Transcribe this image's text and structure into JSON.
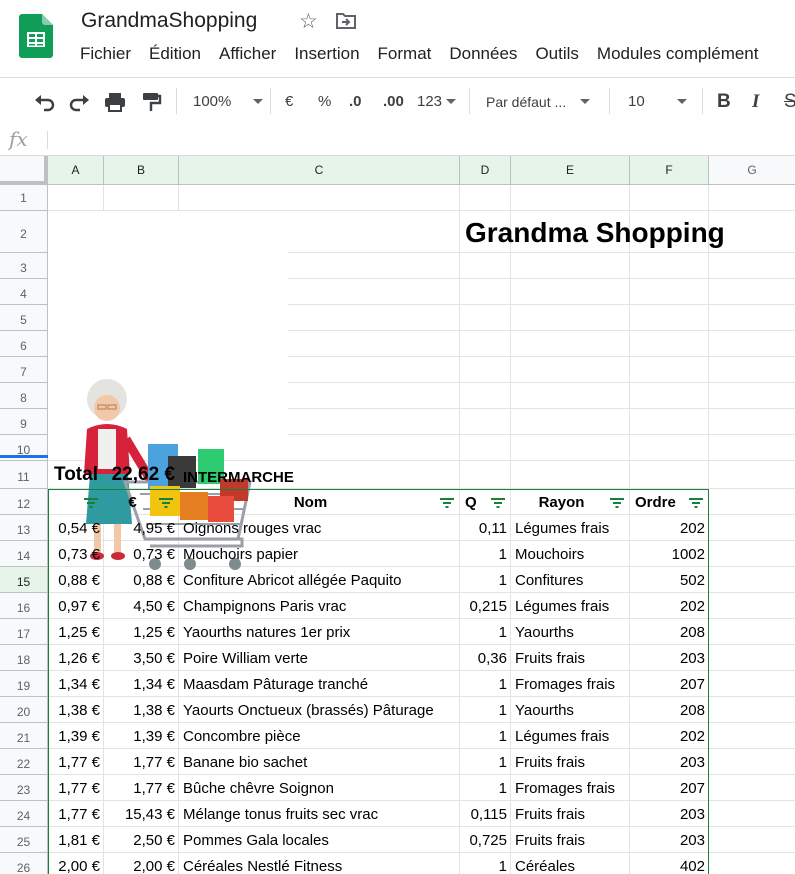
{
  "doc": {
    "title": "GrandmaShopping"
  },
  "menu": [
    "Fichier",
    "Édition",
    "Afficher",
    "Insertion",
    "Format",
    "Données",
    "Outils",
    "Modules complément"
  ],
  "toolbar": {
    "zoom": "100%",
    "currency": "€",
    "percent": "%",
    "dec_less": ".0",
    "dec_more": ".00",
    "number_format": "123",
    "font": "Par défaut ...",
    "font_size": "10",
    "bold": "B",
    "italic": "I",
    "strike": "S"
  },
  "formula_bar": {
    "fx": "fx",
    "value": ""
  },
  "columns": [
    "A",
    "B",
    "C",
    "D",
    "E",
    "F",
    "G"
  ],
  "rows": [
    "1",
    "2",
    "3",
    "4",
    "5",
    "6",
    "7",
    "8",
    "9",
    "10",
    "11",
    "12",
    "13",
    "14",
    "15",
    "16",
    "17",
    "18",
    "19",
    "20",
    "21",
    "22",
    "23",
    "24",
    "25",
    "26"
  ],
  "sheet": {
    "title": "Grandma Shopping",
    "total_label": "Total",
    "total_value": "22,62 €",
    "store": "INTERMARCHE",
    "headers": {
      "a": "",
      "b": "€",
      "c": "Nom",
      "d": "Q",
      "e": "Rayon",
      "f": "Ordre"
    },
    "data": [
      [
        "0,54 €",
        "4,95 €",
        "Oignons rouges vrac",
        "0,11",
        "Légumes frais",
        "202"
      ],
      [
        "0,73 €",
        "0,73 €",
        "Mouchoirs papier",
        "1",
        "Mouchoirs",
        "1002"
      ],
      [
        "0,88 €",
        "0,88 €",
        "Confiture Abricot allégée Paquito",
        "1",
        "Confitures",
        "502"
      ],
      [
        "0,97 €",
        "4,50 €",
        "Champignons Paris vrac",
        "0,215",
        "Légumes frais",
        "202"
      ],
      [
        "1,25 €",
        "1,25 €",
        "Yaourths natures 1er prix",
        "1",
        "Yaourths",
        "208"
      ],
      [
        "1,26 €",
        "3,50 €",
        "Poire William verte",
        "0,36",
        "Fruits frais",
        "203"
      ],
      [
        "1,34 €",
        "1,34 €",
        "Maasdam Pâturage tranché",
        "1",
        "Fromages frais",
        "207"
      ],
      [
        "1,38 €",
        "1,38 €",
        "Yaourts Onctueux (brassés) Pâturage",
        "1",
        "Yaourths",
        "208"
      ],
      [
        "1,39 €",
        "1,39 €",
        "Concombre pièce",
        "1",
        "Légumes frais",
        "202"
      ],
      [
        "1,77 €",
        "1,77 €",
        "Banane bio sachet",
        "1",
        "Fruits frais",
        "203"
      ],
      [
        "1,77 €",
        "1,77 €",
        "Bûche chêvre Soignon",
        "1",
        "Fromages frais",
        "207"
      ],
      [
        "1,77 €",
        "15,43 €",
        "Mélange tonus fruits sec vrac",
        "0,115",
        "Fruits frais",
        "203"
      ],
      [
        "1,81 €",
        "2,50 €",
        "Pommes Gala locales",
        "0,725",
        "Fruits frais",
        "203"
      ],
      [
        "2,00 €",
        "2,00 €",
        "Céréales Nestlé Fitness",
        "1",
        "Céréales",
        "402"
      ]
    ]
  },
  "colors": {
    "selected_header": "#e6f4ea",
    "accent": "#1a73e8",
    "sheets_green": "#0f9d58"
  }
}
